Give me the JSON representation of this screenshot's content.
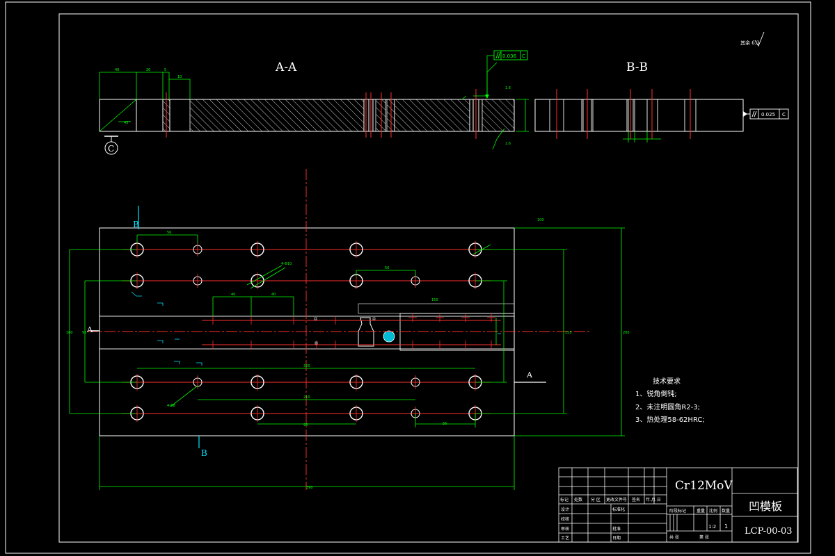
{
  "sections": {
    "aa_title": "A-A",
    "bb_title": "B-B"
  },
  "datum": {
    "c_label": "C"
  },
  "tolerances": {
    "parallel_top": "0.036",
    "parallel_top_datum": "C",
    "parallel_right": "0.025",
    "parallel_right_datum": "C"
  },
  "roughness": {
    "corner": "其余 6.3"
  },
  "section_markers": {
    "a_left": "A",
    "a_right": "A",
    "b_top": "B",
    "b_bottom": "B"
  },
  "tech_requirements": {
    "heading": "技术要求",
    "items": [
      "1、锐角倒钝;",
      "2、未注明圆角R2-3;",
      "3、热处理58-62HRC;"
    ]
  },
  "title_block": {
    "material": "Cr12MoV",
    "part_name": "凹模板",
    "drawing_number": "LCP-00-03",
    "scale": "1:2",
    "quantity": "1",
    "header_cells": [
      "标记",
      "处数",
      "分 区",
      "更改文件号",
      "签名",
      "年.月.日"
    ],
    "stage_cells": [
      "阶段标记",
      "重量",
      "比例",
      "数量"
    ],
    "sheet_cells": [
      "共 张",
      "第 张"
    ],
    "role_cells": [
      "设计",
      "校核",
      "审核",
      "工艺"
    ],
    "role_cells_right": [
      "标准化",
      "批准",
      "日期"
    ]
  },
  "colors": {
    "outline": "#ffffff",
    "centerline": "#ff3030",
    "dimension": "#00ff00",
    "section_mark": "#00e5ff",
    "hatch": "#ffffff",
    "hole_fill": "#00bcd4"
  }
}
